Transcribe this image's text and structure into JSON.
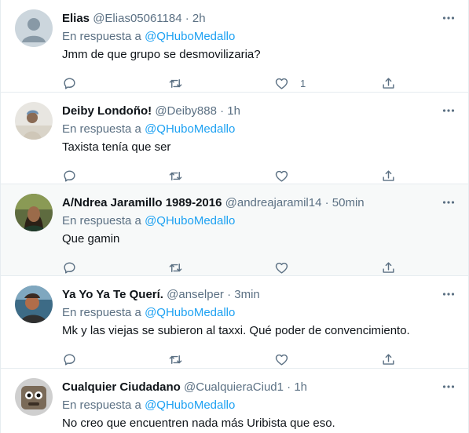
{
  "reply_prefix": "En respuesta a",
  "tweets": [
    {
      "name": "Elias",
      "handle": "@Elias05061184",
      "sep": "·",
      "time": "2h",
      "reply_to": "@QHuboMedallo",
      "text": "Jmm de que grupo se desmovilizaria?",
      "likes": "1"
    },
    {
      "name": "Deiby Londoño!",
      "handle": "@Deiby888",
      "sep": "·",
      "time": "1h",
      "reply_to": "@QHuboMedallo",
      "text": "Taxista tenía que ser",
      "likes": ""
    },
    {
      "name": "A/Ndrea Jaramillo 1989-2016",
      "handle": "@andreajaramil14",
      "sep": "·",
      "time": "50min",
      "reply_to": "@QHuboMedallo",
      "text": "Que gamin",
      "likes": ""
    },
    {
      "name": "Ya Yo Ya Te Querí.",
      "handle": "@anselper",
      "sep": "·",
      "time": "3min",
      "reply_to": "@QHuboMedallo",
      "text": "Mk y las viejas se subieron al taxxi. Qué poder de convencimiento.",
      "likes": ""
    },
    {
      "name": "Cualquier Ciudadano",
      "handle": "@CualquieraCiud1",
      "sep": "·",
      "time": "1h",
      "reply_to": "@QHuboMedallo",
      "text": "No creo que encuentren nada más Uribista que eso.",
      "likes": ""
    }
  ],
  "icons": {
    "more": "more-horizontal-icon",
    "reply": "reply-icon",
    "retweet": "retweet-icon",
    "like": "heart-icon",
    "share": "share-icon"
  },
  "colors": {
    "link": "#1da1f2",
    "secondary_text": "#5b7083",
    "highlight_bg": "#f7f9f9",
    "divider": "#e6ecf0"
  }
}
